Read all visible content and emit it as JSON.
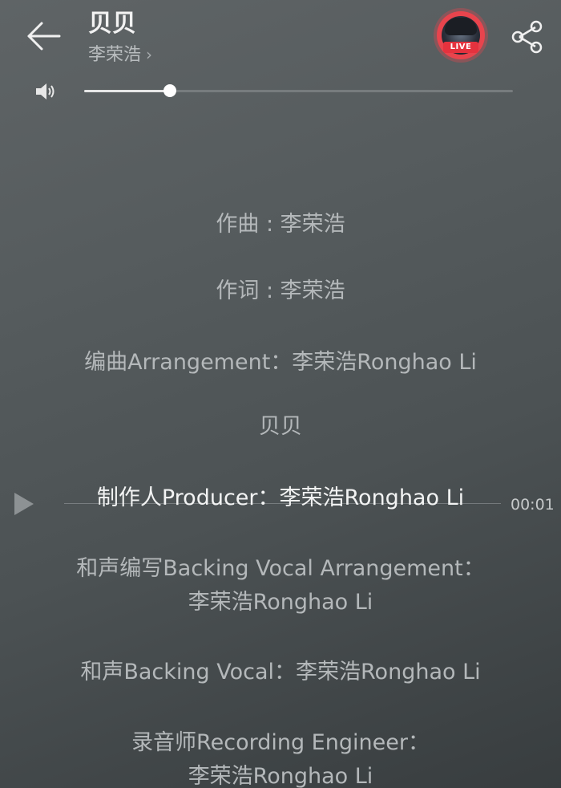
{
  "header": {
    "title": "贝贝",
    "artist": "李荣浩",
    "artist_chevron": "›",
    "live_badge": "LIVE"
  },
  "icons": {
    "back": "back-arrow-icon",
    "share": "share-icon",
    "volume": "speaker-icon",
    "play": "play-icon"
  },
  "volume": {
    "level": 0.2
  },
  "lyrics": [
    "作曲 : 李荣浩",
    "作词 : 李荣浩",
    "编曲Arrangement：李荣浩Ronghao Li",
    "贝贝",
    "制作人Producer：李荣浩Ronghao Li",
    "和声编写Backing Vocal Arrangement：",
    "李荣浩Ronghao Li",
    "和声Backing Vocal：李荣浩Ronghao Li",
    "录音师Recording Engineer：",
    "李荣浩Ronghao Li"
  ],
  "seek": {
    "time": "00:01"
  },
  "colors": {
    "live_red": "#e5323e",
    "text_primary": "#f2f3f3",
    "text_secondary": "#b4b8ba"
  }
}
